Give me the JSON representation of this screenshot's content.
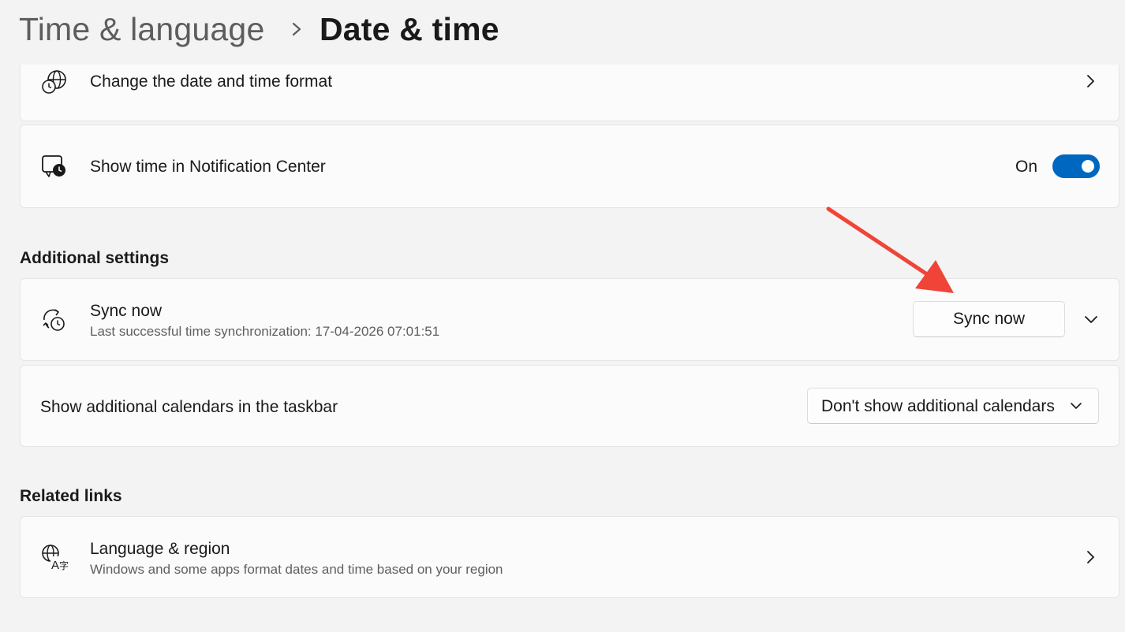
{
  "breadcrumb": {
    "parent": "Time & language",
    "separator_icon": "chevron-right-icon",
    "current": "Date & time"
  },
  "rows": {
    "date_format": {
      "title": "Change the date and time format",
      "icon": "globe-clock-icon"
    },
    "notification_center": {
      "title": "Show time in Notification Center",
      "icon": "notification-clock-icon",
      "toggle_label": "On",
      "toggle_on": true,
      "toggle_color": "#0067c0"
    }
  },
  "additional_settings": {
    "heading": "Additional settings",
    "sync": {
      "title": "Sync now",
      "subtitle": "Last successful time synchronization: 17-04-2026 07:01:51",
      "button_label": "Sync now",
      "icon": "sync-clock-icon"
    },
    "calendars": {
      "title": "Show additional calendars in the taskbar",
      "selected": "Don't show additional calendars"
    }
  },
  "related_links": {
    "heading": "Related links",
    "language_region": {
      "title": "Language & region",
      "subtitle": "Windows and some apps format dates and time based on your region",
      "icon": "language-icon"
    }
  },
  "annotation": {
    "arrow_color": "#f04438",
    "arrow_icon": "red-arrow-icon"
  }
}
